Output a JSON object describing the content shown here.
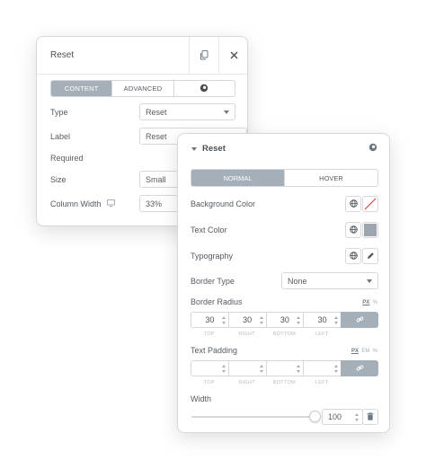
{
  "back_panel": {
    "title": "Reset",
    "tabs": [
      {
        "label": "CONTENT"
      },
      {
        "label": "ADVANCED"
      },
      {
        "label": ""
      }
    ],
    "fields": {
      "type": {
        "label": "Type",
        "value": "Reset"
      },
      "label": {
        "label": "Label",
        "value": "Reset"
      },
      "required": {
        "label": "Required"
      },
      "size": {
        "label": "Size",
        "value": "Small"
      },
      "column_width": {
        "label": "Column Width",
        "value": "33%"
      }
    }
  },
  "front_panel": {
    "title": "Reset",
    "tabs": [
      {
        "label": "NORMAL"
      },
      {
        "label": "HOVER"
      }
    ],
    "background_color": {
      "label": "Background Color"
    },
    "text_color": {
      "label": "Text Color",
      "swatch": "#9da5ae"
    },
    "typography": {
      "label": "Typography"
    },
    "border_type": {
      "label": "Border Type",
      "value": "None"
    },
    "border_radius": {
      "label": "Border Radius",
      "units": [
        "PX",
        "%"
      ],
      "values": [
        "30",
        "30",
        "30",
        "30"
      ],
      "sides": [
        "TOP",
        "RIGHT",
        "BOTTOM",
        "LEFT"
      ]
    },
    "text_padding": {
      "label": "Text Padding",
      "units": [
        "PX",
        "EM",
        "%"
      ],
      "values": [
        "",
        "",
        "",
        ""
      ],
      "sides": [
        "TOP",
        "RIGHT",
        "BOTTOM",
        "LEFT"
      ]
    },
    "width": {
      "label": "Width",
      "value": "100",
      "slider_fraction": 1.0
    }
  },
  "colors": {
    "tab_active": "#a4afb7",
    "border": "#d5d8dc",
    "text": "#555c63",
    "no_color_slash": "#e04b3c"
  },
  "icons": [
    "copy-icon",
    "close-icon",
    "style-icon",
    "chevron-down-icon",
    "globe-icon",
    "pencil-icon",
    "link-icon",
    "monitor-icon",
    "trash-icon"
  ]
}
